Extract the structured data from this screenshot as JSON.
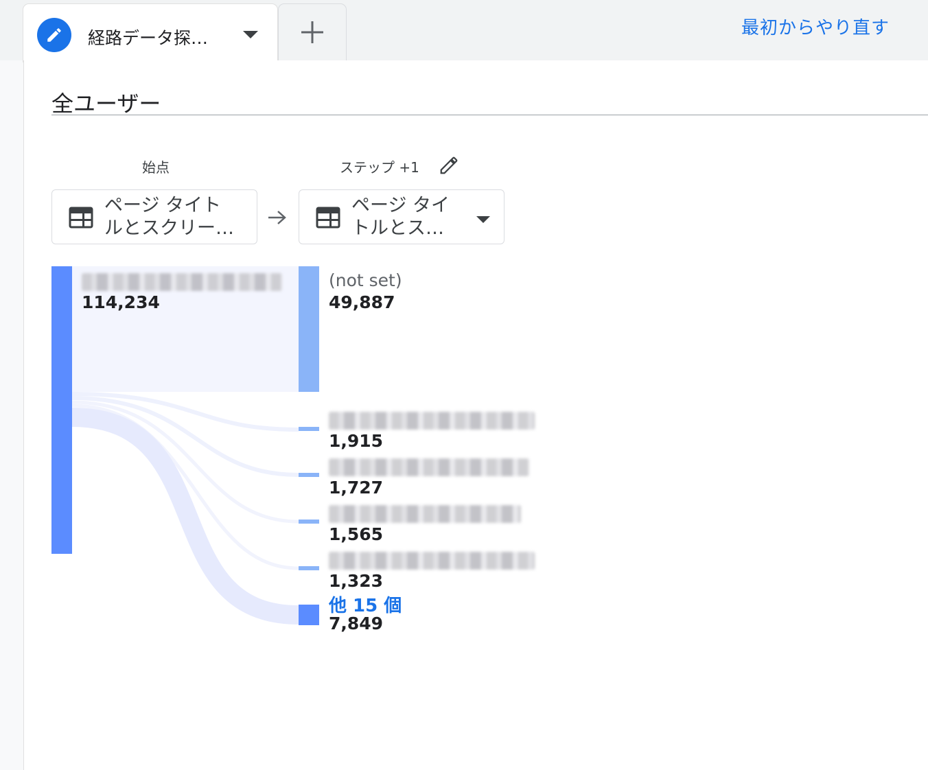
{
  "tabs": {
    "active_label": "経路データ探…",
    "add_symbol": "+"
  },
  "reset_label": "最初からやり直す",
  "segment": {
    "title": "全ユーザー"
  },
  "steps": {
    "start": {
      "label": "始点",
      "dimension": [
        "ページ タイト",
        "ルとスクリー…"
      ]
    },
    "step1": {
      "label": "ステップ +1",
      "dimension": [
        "ページ タイ",
        "トルとスク…"
      ]
    }
  },
  "start_node": {
    "label": "",
    "value": "114,234"
  },
  "step_nodes": [
    {
      "label": "(not set)",
      "value": "49,887"
    },
    {
      "label": "",
      "value": "1,915"
    },
    {
      "label": "",
      "value": "1,727"
    },
    {
      "label": "",
      "value": "1,565"
    },
    {
      "label": "",
      "value": "1,323"
    },
    {
      "label": "他 15 個",
      "value": "7,849"
    }
  ],
  "colors": {
    "accent": "#1a73e8",
    "start_bar": "#5b8cff",
    "step_bar_light": "#8ab4f8",
    "link_fill": "#e8ecfd",
    "others_bar": "#5b8cff"
  },
  "icons": {
    "tab": "pencil-icon",
    "dimension": "table-icon",
    "dropdown": "caret-down-icon",
    "between": "arrow-right-icon",
    "edit_step": "pencil-icon"
  }
}
